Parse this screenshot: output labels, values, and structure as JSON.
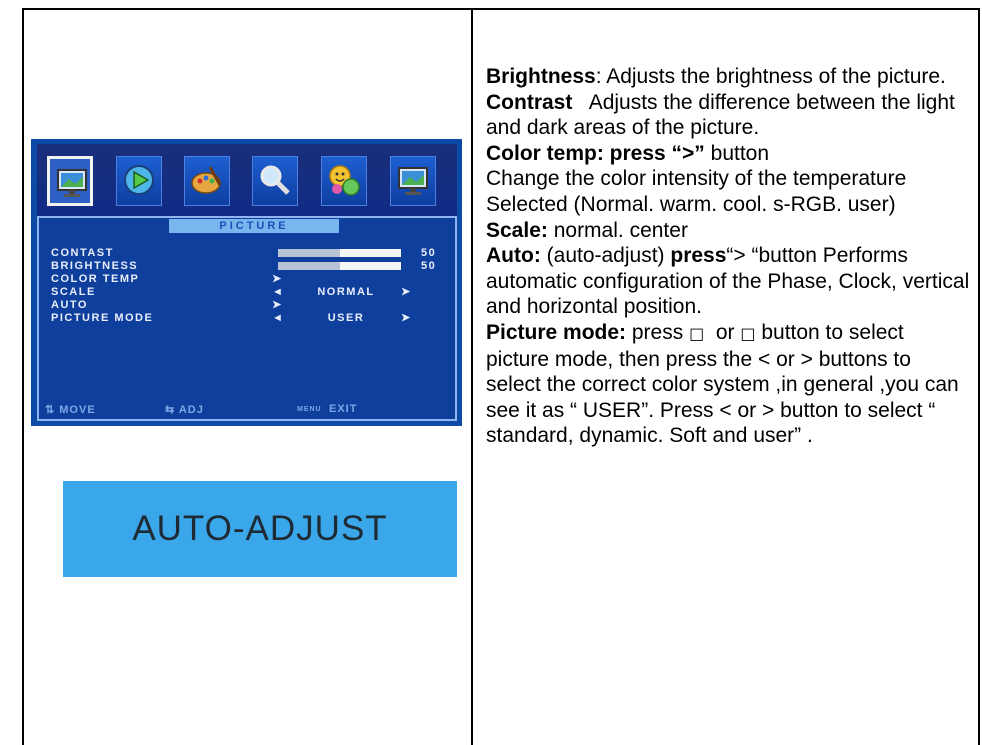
{
  "osd": {
    "icons": [
      "monitor-picture-icon",
      "play-icon",
      "palette-icon",
      "magnifier-icon",
      "smiley-icon",
      "monitor-icon"
    ],
    "title": "PICTURE",
    "rows": [
      {
        "label": "CONTAST",
        "value": "50",
        "level": 0.5
      },
      {
        "label": "BRIGHTNESS",
        "value": "50",
        "level": 0.5
      },
      {
        "label": "COLOR TEMP",
        "arrow": "➤"
      },
      {
        "label": "SCALE",
        "left": "◄",
        "option": "NORMAL",
        "right": "➤"
      },
      {
        "label": "AUTO",
        "arrow": "➤"
      },
      {
        "label": "PICTURE MODE",
        "left": "◄",
        "option": "USER",
        "right": "➤"
      }
    ],
    "footer": {
      "move": "⇅ MOVE",
      "adj": "⇆ ADJ",
      "exit_prefix": "MENU",
      "exit": "EXIT"
    }
  },
  "banner": {
    "text": "AUTO-ADJUST"
  },
  "desc": {
    "brightness_term": "Brightness",
    "brightness_text": ": Adjusts the brightness of the picture.",
    "contrast_term": "Contrast",
    "contrast_text": "   Adjusts the difference between the light and dark areas of the picture.",
    "colortemp_term": "Color temp: press “>”",
    "colortemp_btn": " button",
    "colortemp_text": "Change the color intensity of the temperature Selected (Normal. warm. cool. s-RGB. user)",
    "scale_term": "Scale:",
    "scale_text": " normal. center",
    "auto_term": "Auto:",
    "auto_mid": " (auto-adjust) ",
    "auto_press": "press",
    "auto_text": "“> “button Performs automatic configuration of the Phase, Clock, vertical and horizontal position.",
    "pmode_term": "Picture mode:",
    "pmode_press": " press ",
    "pmode_sym1": "□",
    "pmode_or": "  or ",
    "pmode_sym2": "□",
    "pmode_text": " button to select picture mode, then press the < or > buttons to select the correct color system ,in general ,you can see it as “ USER”. Press < or > button to select “ standard, dynamic. Soft and user” ."
  },
  "colors": {
    "osd_bg": "#0d4aa6",
    "banner_bg": "#3aa7ea",
    "title_bar": "#79b6ee"
  }
}
